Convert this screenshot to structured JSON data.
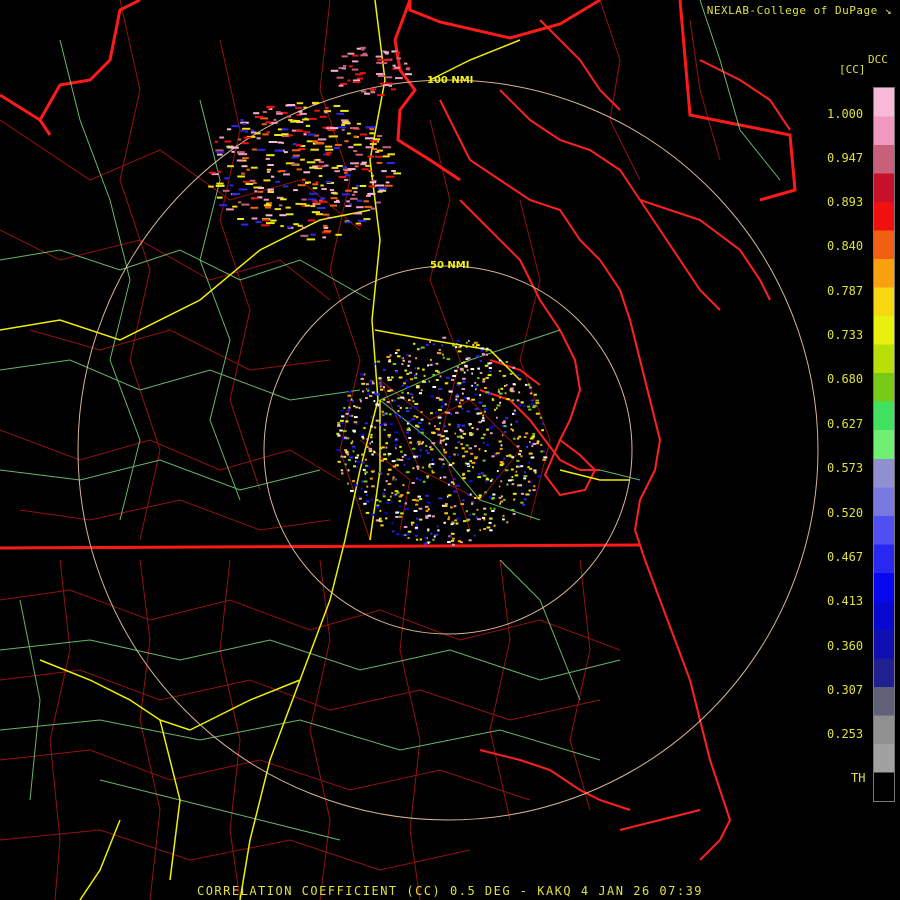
{
  "header": {
    "credit": "NEXLAB-College of DuPage"
  },
  "legend": {
    "product_code": "DCC",
    "unit": "[CC]",
    "ticks": [
      "1.000",
      "0.947",
      "0.893",
      "0.840",
      "0.787",
      "0.733",
      "0.680",
      "0.627",
      "0.573",
      "0.520",
      "0.467",
      "0.413",
      "0.360",
      "0.307",
      "0.253",
      "TH"
    ],
    "colors": [
      "#f8b8d8",
      "#f098c0",
      "#c8607a",
      "#c8102a",
      "#f01010",
      "#f06010",
      "#f8a010",
      "#f8d810",
      "#e8f010",
      "#b8e008",
      "#78c818",
      "#40e060",
      "#70f070",
      "#9090d0",
      "#7878e0",
      "#5050f0",
      "#2828f0",
      "#0808f0",
      "#0808d0",
      "#1010b0",
      "#202090",
      "#606078",
      "#909090",
      "#a0a0a0",
      "#000000"
    ]
  },
  "map": {
    "range_rings": [
      {
        "label": "50 NMI"
      },
      {
        "label": "100 NMI"
      }
    ],
    "colors": {
      "state_border": "#ff2020",
      "county_border": "#c01818",
      "coastline": "#ff2020",
      "highway": "#f0f000",
      "road": "#80e080",
      "range_ring": "#f0c8a0"
    }
  },
  "footer": {
    "caption": "CORRELATION COEFFICIENT (CC) 0.5 DEG - KAKQ 4 JAN 26 07:39"
  }
}
